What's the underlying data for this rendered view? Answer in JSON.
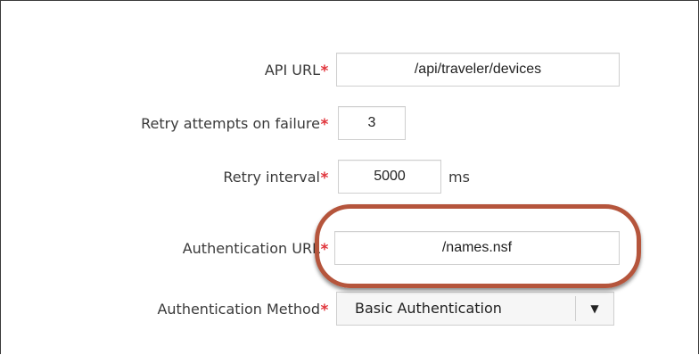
{
  "form": {
    "required_marker": "*",
    "api_url": {
      "label": "API URL",
      "value": "/api/traveler/devices"
    },
    "retry_attempts": {
      "label": "Retry attempts on failure",
      "value": "3"
    },
    "retry_interval": {
      "label": "Retry interval",
      "value": "5000",
      "unit": "ms"
    },
    "auth_url": {
      "label": "Authentication URL",
      "value": "/names.nsf"
    },
    "auth_method": {
      "label": "Authentication Method",
      "selected": "Basic Authentication"
    }
  },
  "annotation": {
    "highlight_color": "#b5553c"
  },
  "colors": {
    "required": "#e0343b",
    "label": "#3a3a3a",
    "input_border": "#cfcfcf"
  }
}
